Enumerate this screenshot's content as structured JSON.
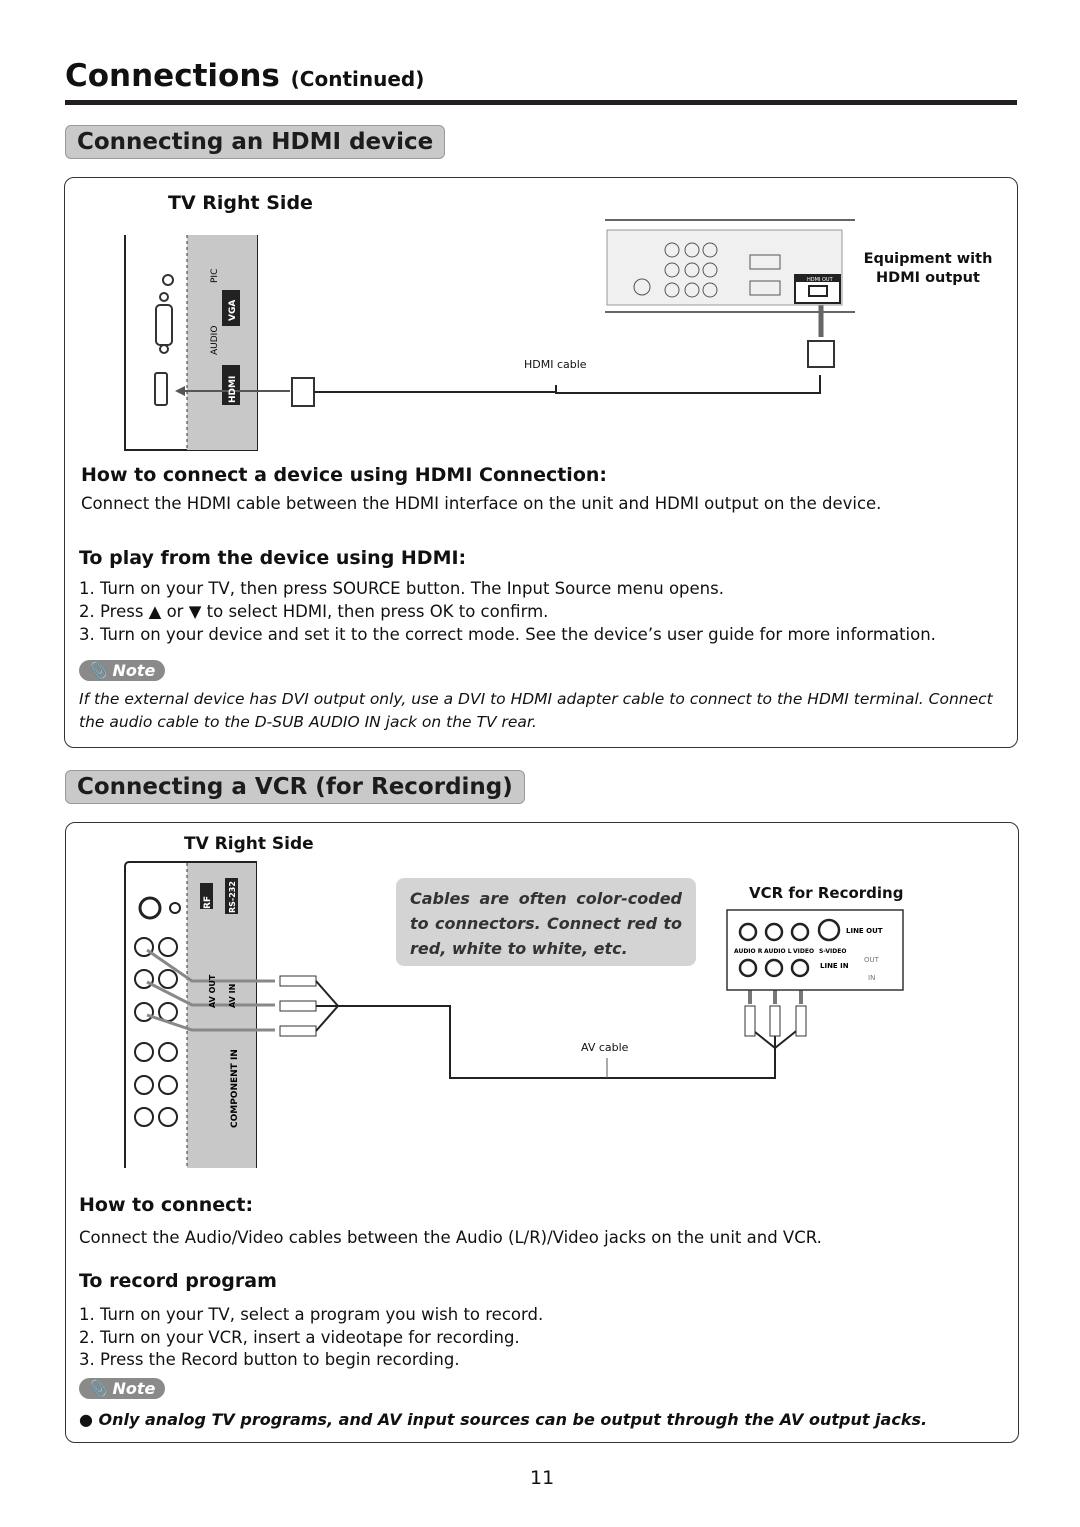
{
  "header": {
    "title": "Connections",
    "continued": "(Continued)"
  },
  "hdmi": {
    "section_title": "Connecting an HDMI device",
    "tv_side": "TV Right Side",
    "port_labels": {
      "pic": "PIC",
      "audio": "AUDIO",
      "vga": "VGA",
      "hdmi": "HDMI"
    },
    "equipment_label_1": "Equipment with",
    "equipment_label_2": "HDMI output",
    "device_port": "HDMI OUT",
    "cable_label": "HDMI cable",
    "how_title": "How to connect a device using HDMI Connection:",
    "how_text": "Connect the HDMI cable between the HDMI interface on the unit and HDMI output on the device.",
    "play_title": "To play from the device using HDMI:",
    "steps": [
      "1. Turn on your TV,  then press SOURCE button. The Input Source menu opens.",
      "2. Press ▲ or ▼ to select HDMI, then press OK to confirm.",
      "3. Turn on your device and set it to the correct mode. See the device’s user guide for more information."
    ],
    "note_label": "Note",
    "note_text": "If the external device has DVI output only, use a DVI to HDMI adapter cable to connect to the HDMI terminal. Connect the audio cable to the D-SUB AUDIO IN jack on the TV rear."
  },
  "vcr": {
    "section_title": "Connecting a VCR (for Recording)",
    "tv_side": "TV Right Side",
    "port_labels": {
      "rf": "RF",
      "rs232": "RS-232",
      "av_out": "AV OUT",
      "av_in": "AV IN",
      "component": "COMPONENT IN"
    },
    "callout": "Cables are often color-coded to connectors. Connect red to red, white to white, etc.",
    "vcr_label": "VCR for Recording",
    "vcr_ports": {
      "line_out": "LINE OUT",
      "audio_r": "AUDIO R",
      "audio_l": "AUDIO L",
      "video": "VIDEO",
      "svideo": "S-VIDEO",
      "line_in": "LINE IN",
      "out": "OUT",
      "in": "IN"
    },
    "cable_label": "AV cable",
    "how_title": "How to connect:",
    "how_text": "Connect the Audio/Video cables between the Audio (L/R)/Video jacks on the unit and VCR.",
    "record_title": "To record program",
    "steps": [
      "1. Turn on your TV, select a program you wish to record.",
      "2. Turn on your VCR, insert a videotape for recording.",
      "3. Press the Record button to begin recording."
    ],
    "note_label": "Note",
    "note_text": "● Only analog TV programs, and AV input sources can be output through the AV output jacks."
  },
  "footer": {
    "page_number": "11"
  }
}
